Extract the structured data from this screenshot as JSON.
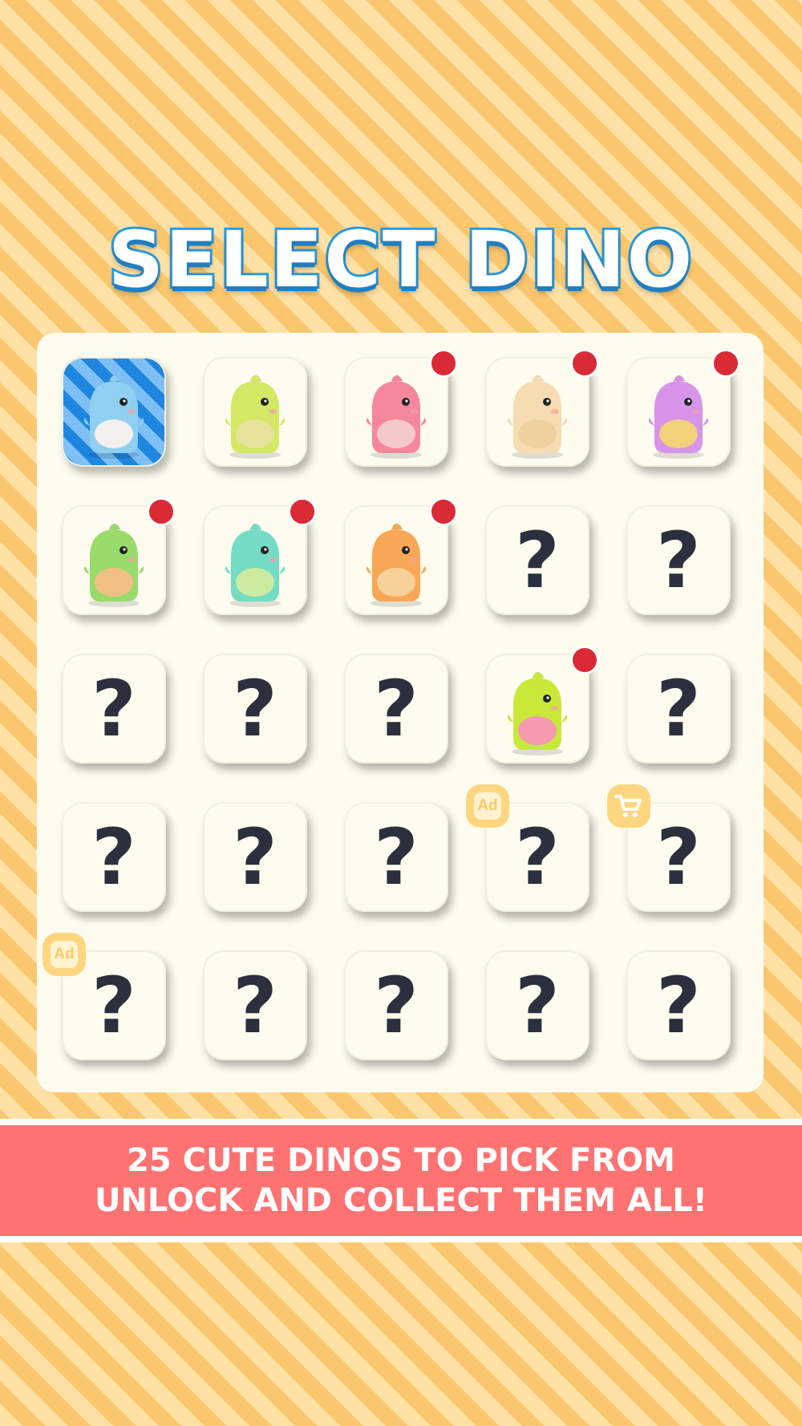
{
  "title": "SELECT DINO",
  "banner": {
    "line1": "25 CUTE DINOS TO PICK FROM",
    "line2": "UNLOCK AND COLLECT THEM ALL!"
  },
  "locked_symbol": "?",
  "ad_label": "Ad",
  "colors": {
    "background_stripe_light": "#ffe1a6",
    "background_stripe_dark": "#fbc76e",
    "title_outline": "#2a9ae0",
    "panel": "#fdfcef",
    "new_dot": "#d92a35",
    "banner": "#ff7272",
    "badge": "#ffd680"
  },
  "dinos": [
    {
      "status": "selected",
      "color": "#8fd0f0",
      "belly": "#f4f0ee",
      "new": false,
      "badge": null
    },
    {
      "status": "unlocked",
      "color": "#d3e865",
      "belly": "#e6e29c",
      "new": false,
      "badge": null
    },
    {
      "status": "unlocked",
      "color": "#f6879a",
      "belly": "#f4c9cb",
      "new": true,
      "badge": null
    },
    {
      "status": "unlocked",
      "color": "#f6dcb0",
      "belly": "#f1d0a0",
      "new": true,
      "badge": null
    },
    {
      "status": "unlocked",
      "color": "#d894e8",
      "belly": "#f1d27a",
      "new": true,
      "badge": null
    },
    {
      "status": "unlocked",
      "color": "#98db6b",
      "belly": "#f2bf83",
      "new": true,
      "badge": null
    },
    {
      "status": "unlocked",
      "color": "#74dcc4",
      "belly": "#cdeba0",
      "new": true,
      "badge": null
    },
    {
      "status": "unlocked",
      "color": "#f8a756",
      "belly": "#f8d09a",
      "new": true,
      "badge": null
    },
    {
      "status": "locked",
      "new": false,
      "badge": null
    },
    {
      "status": "locked",
      "new": false,
      "badge": null
    },
    {
      "status": "locked",
      "new": false,
      "badge": null
    },
    {
      "status": "locked",
      "new": false,
      "badge": null
    },
    {
      "status": "locked",
      "new": false,
      "badge": null
    },
    {
      "status": "unlocked",
      "color": "#c8e83a",
      "belly": "#f59ab0",
      "new": true,
      "badge": null
    },
    {
      "status": "locked",
      "new": false,
      "badge": null
    },
    {
      "status": "locked",
      "new": false,
      "badge": null
    },
    {
      "status": "locked",
      "new": false,
      "badge": null
    },
    {
      "status": "locked",
      "new": false,
      "badge": null
    },
    {
      "status": "locked",
      "new": false,
      "badge": "ad"
    },
    {
      "status": "locked",
      "new": false,
      "badge": "cart"
    },
    {
      "status": "locked",
      "new": false,
      "badge": "ad"
    },
    {
      "status": "locked",
      "new": false,
      "badge": null
    },
    {
      "status": "locked",
      "new": false,
      "badge": null
    },
    {
      "status": "locked",
      "new": false,
      "badge": null
    },
    {
      "status": "locked",
      "new": false,
      "badge": null
    }
  ]
}
